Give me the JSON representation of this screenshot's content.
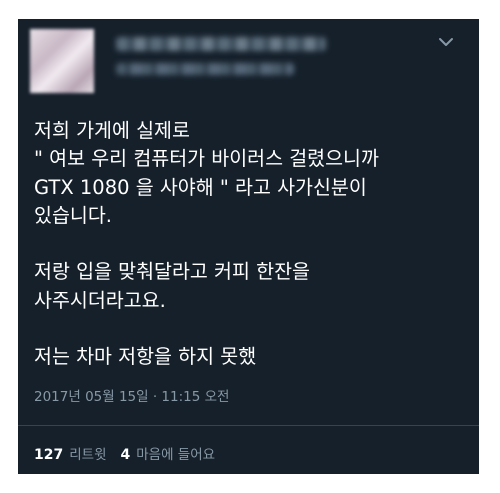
{
  "tweet": {
    "author_name_redacted": true,
    "text": "저희 가게에 실제로\n\" 여보 우리 컴퓨터가 바이러스 걸렸으니까\nGTX 1080 을 사야해 \" 라고 사가신분이\n있습니다.\n\n저랑 입을 맞춰달라고 커피 한잔을\n사주시더라고요.\n\n저는 차마 저항을 하지 못했",
    "timestamp": "2017년 05월 15일 · 11:15 오전"
  },
  "stats": {
    "retweets_count": "127",
    "retweets_label": "리트윗",
    "likes_count": "4",
    "likes_label": "마음에 들어요"
  },
  "icons": {
    "chevron": "chevron-down-icon"
  },
  "colors": {
    "background": "#15202b",
    "text": "#ffffff",
    "muted": "#8899a6",
    "divider": "#38444d"
  }
}
